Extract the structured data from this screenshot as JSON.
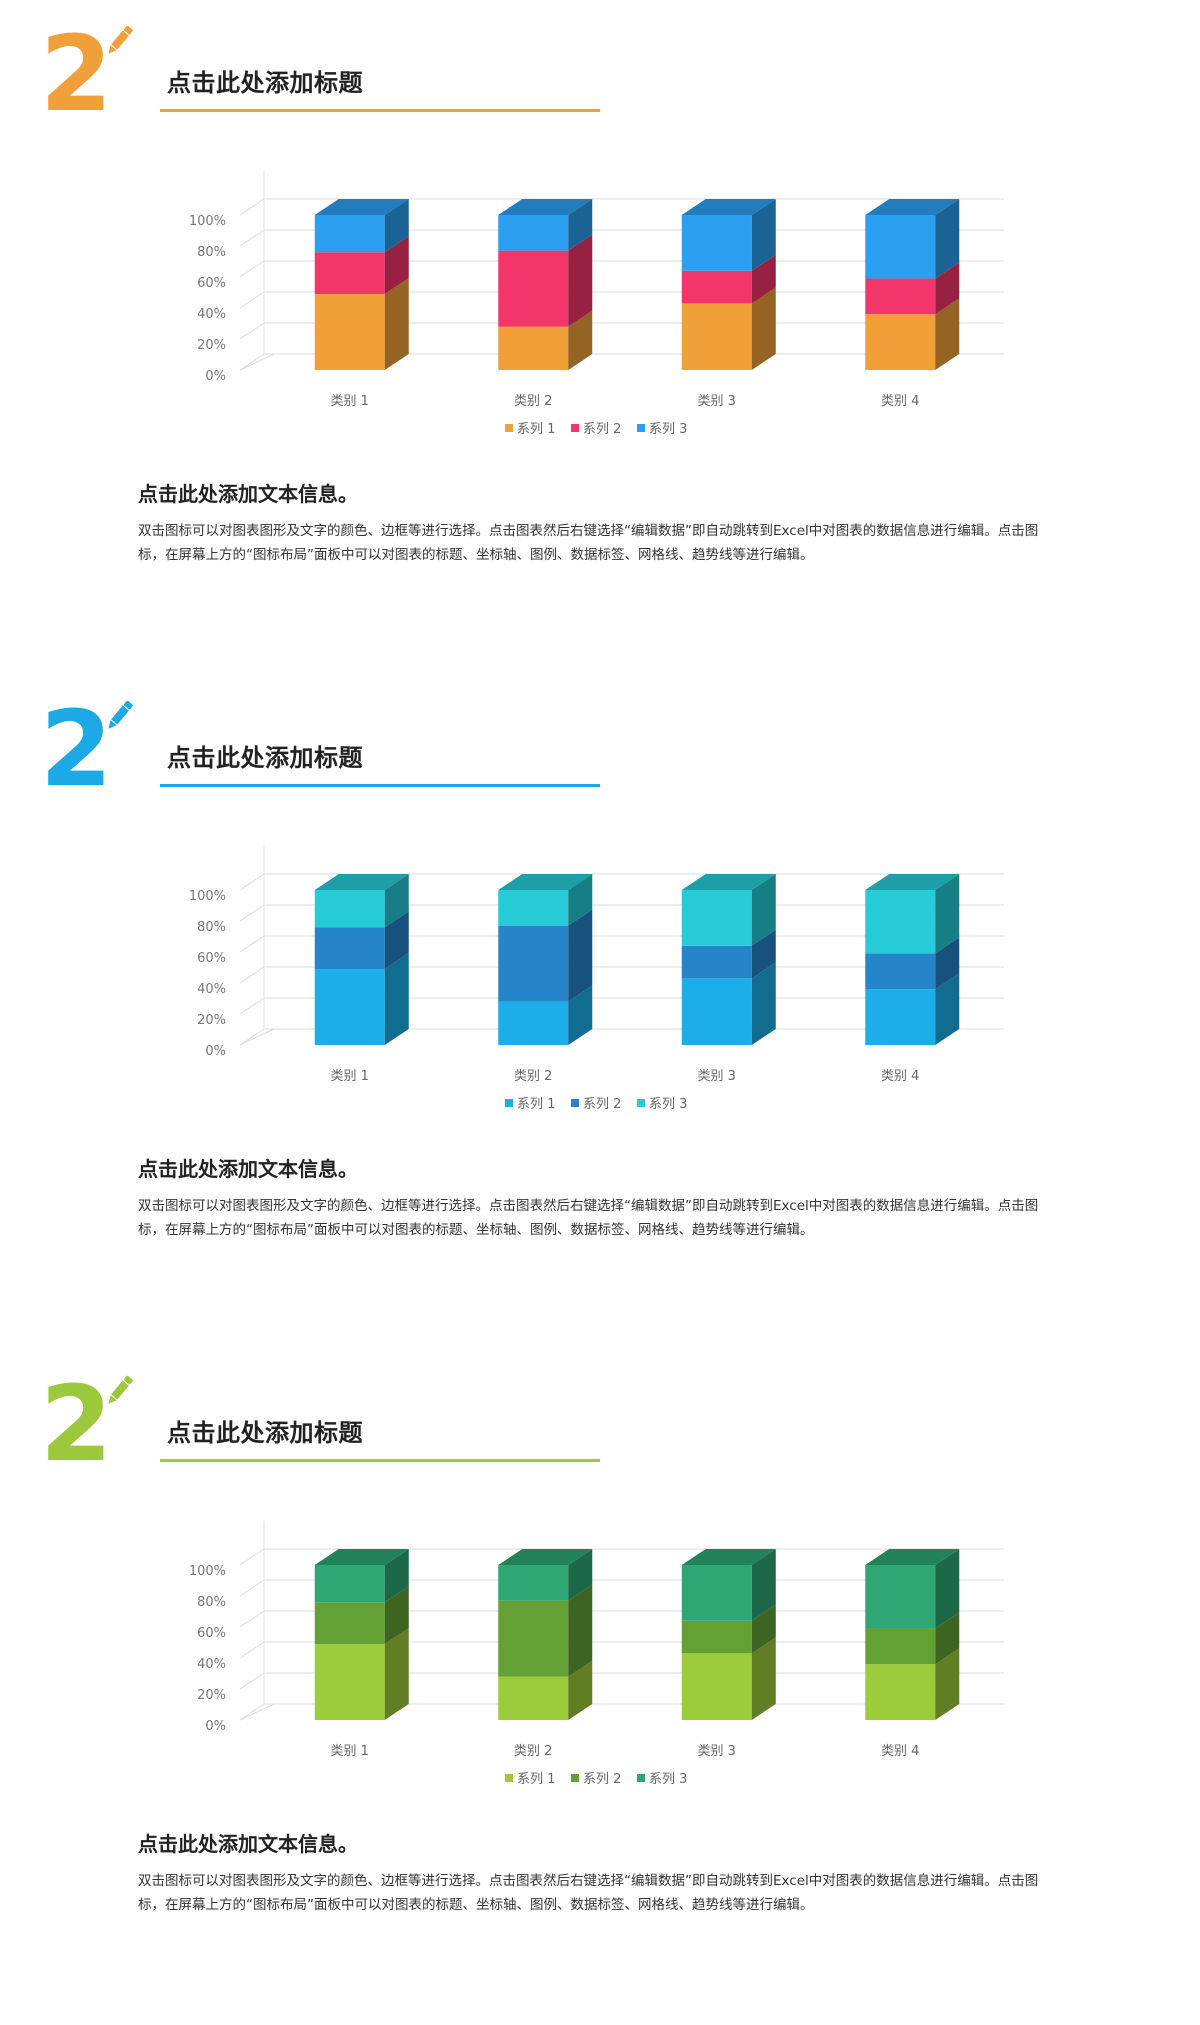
{
  "sections": [
    {
      "number": "2",
      "title": "点击此处添加标题",
      "accent": "#f19f38",
      "colors": [
        "#f19f38",
        "#f2366b",
        "#2d9ff0"
      ],
      "subheading": "点击此处添加文本信息。",
      "body": "双击图标可以对图表图形及文字的颜色、边框等进行选择。点击图表然后右键选择“编辑数据”即自动跳转到Excel中对图表的数据信息进行编辑。点击图标，在屏幕上方的“图标布局”面板中可以对图表的标题、坐标轴、图例、数据标签、网格线、趋势线等进行编辑。"
    },
    {
      "number": "2",
      "title": "点击此处添加标题",
      "accent": "#1da8e6",
      "colors": [
        "#1caee8",
        "#2585c8",
        "#27cbd8"
      ],
      "subheading": "点击此处添加文本信息。",
      "body": "双击图标可以对图表图形及文字的颜色、边框等进行选择。点击图表然后右键选择“编辑数据”即自动跳转到Excel中对图表的数据信息进行编辑。点击图标，在屏幕上方的“图标布局”面板中可以对图表的标题、坐标轴、图例、数据标签、网格线、趋势线等进行编辑。"
    },
    {
      "number": "2",
      "title": "点击此处添加标题",
      "accent": "#9cc93b",
      "colors": [
        "#9ccb3c",
        "#63a135",
        "#2ea774"
      ],
      "subheading": "点击此处添加文本信息。",
      "body": "双击图标可以对图表图形及文字的颜色、边框等进行选择。点击图表然后右键选择“编辑数据”即自动跳转到Excel中对图表的数据信息进行编辑。点击图标，在屏幕上方的“图标布局”面板中可以对图表的标题、坐标轴、图例、数据标签、网格线、趋势线等进行编辑。"
    }
  ],
  "chart_data": [
    {
      "type": "bar",
      "stacked": true,
      "percent": true,
      "three_d": true,
      "categories": [
        "类别 1",
        "类别 2",
        "类别 3",
        "类别 4"
      ],
      "series": [
        {
          "name": "系列 1",
          "values": [
            49,
            28,
            43,
            36
          ]
        },
        {
          "name": "系列 2",
          "values": [
            27,
            49,
            21,
            23
          ]
        },
        {
          "name": "系列 3",
          "values": [
            24,
            23,
            36,
            41
          ]
        }
      ],
      "yticks": [
        "0%",
        "20%",
        "40%",
        "60%",
        "80%",
        "100%"
      ],
      "ylim": [
        0,
        100
      ],
      "grid": true,
      "legend": "bottom"
    },
    {
      "type": "bar",
      "stacked": true,
      "percent": true,
      "three_d": true,
      "categories": [
        "类别 1",
        "类别 2",
        "类别 3",
        "类别 4"
      ],
      "series": [
        {
          "name": "系列 1",
          "values": [
            49,
            28,
            43,
            36
          ]
        },
        {
          "name": "系列 2",
          "values": [
            27,
            49,
            21,
            23
          ]
        },
        {
          "name": "系列 3",
          "values": [
            24,
            23,
            36,
            41
          ]
        }
      ],
      "yticks": [
        "0%",
        "20%",
        "40%",
        "60%",
        "80%",
        "100%"
      ],
      "ylim": [
        0,
        100
      ],
      "grid": true,
      "legend": "bottom"
    },
    {
      "type": "bar",
      "stacked": true,
      "percent": true,
      "three_d": true,
      "categories": [
        "类别 1",
        "类别 2",
        "类别 3",
        "类别 4"
      ],
      "series": [
        {
          "name": "系列 1",
          "values": [
            49,
            28,
            43,
            36
          ]
        },
        {
          "name": "系列 2",
          "values": [
            27,
            49,
            21,
            23
          ]
        },
        {
          "name": "系列 3",
          "values": [
            24,
            23,
            36,
            41
          ]
        }
      ],
      "yticks": [
        "0%",
        "20%",
        "40%",
        "60%",
        "80%",
        "100%"
      ],
      "ylim": [
        0,
        100
      ],
      "grid": true,
      "legend": "bottom"
    }
  ]
}
